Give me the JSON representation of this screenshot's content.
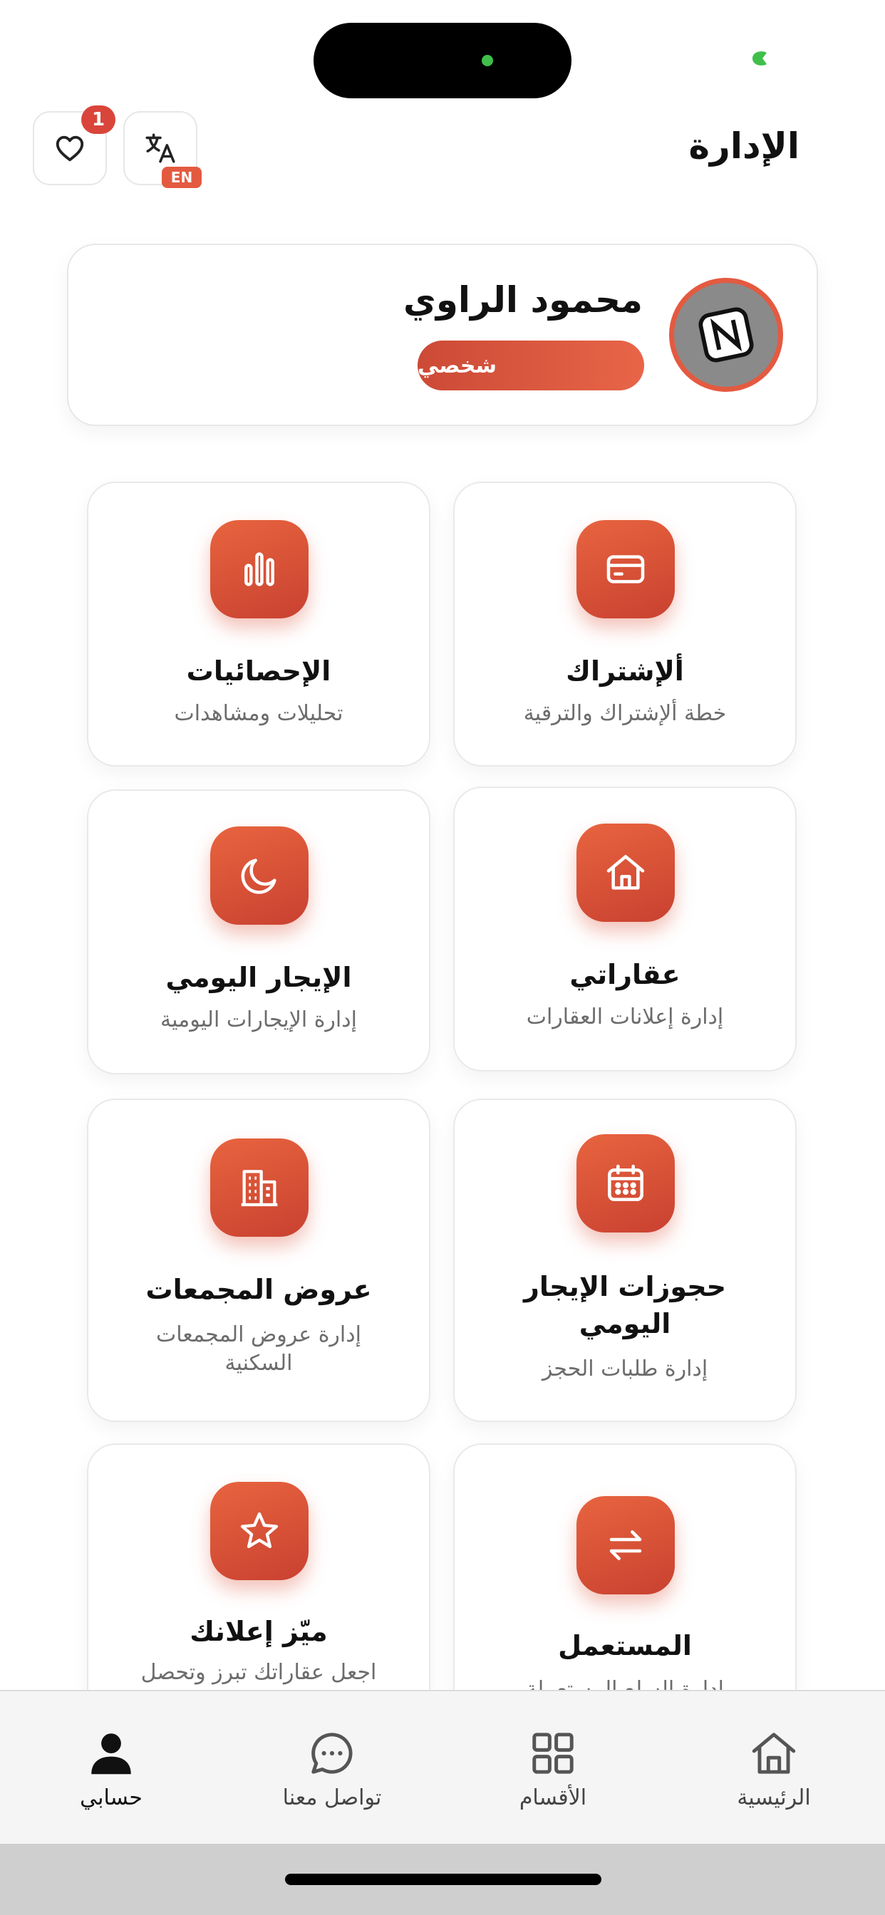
{
  "header": {
    "title": "الإدارة",
    "favorites_count": "1",
    "language_badge": "EN"
  },
  "profile": {
    "name": "محمود الراوي",
    "account_type": "شخصي"
  },
  "colors": {
    "accent": "#E45A40",
    "accent_dark": "#C94130",
    "badge_red": "#D9453A"
  },
  "cards": [
    {
      "icon": "credit-card-icon",
      "title": "ألإشتراك",
      "subtitle": "خطة ألإشتراك والترقية"
    },
    {
      "icon": "bar-chart-icon",
      "title": "الإحصائيات",
      "subtitle": "تحليلات ومشاهدات"
    },
    {
      "icon": "house-icon",
      "title": "عقاراتي",
      "subtitle": "إدارة إعلانات العقارات"
    },
    {
      "icon": "moon-icon",
      "title": "الإيجار اليومي",
      "subtitle": "إدارة الإيجارات اليومية"
    },
    {
      "icon": "calendar-icon",
      "title": "حجوزات الإيجار اليومي",
      "subtitle": "إدارة طلبات الحجز"
    },
    {
      "icon": "building-icon",
      "title": "عروض المجمعات",
      "subtitle": "إدارة عروض المجمعات السكنية"
    },
    {
      "icon": "swap-arrows-icon",
      "title": "المستعمل",
      "subtitle": "إدارة السلع المستعملة"
    },
    {
      "icon": "star-icon",
      "title": "ميّز إعلانك",
      "subtitle": "اجعل عقاراتك تبرز وتحصل"
    }
  ],
  "nav": {
    "items": [
      {
        "icon": "home-icon",
        "label": "الرئيسية"
      },
      {
        "icon": "grid-icon",
        "label": "الأقسام"
      },
      {
        "icon": "chat-icon",
        "label": "تواصل معنا"
      },
      {
        "icon": "user-icon",
        "label": "حسابي",
        "active": true
      }
    ]
  }
}
